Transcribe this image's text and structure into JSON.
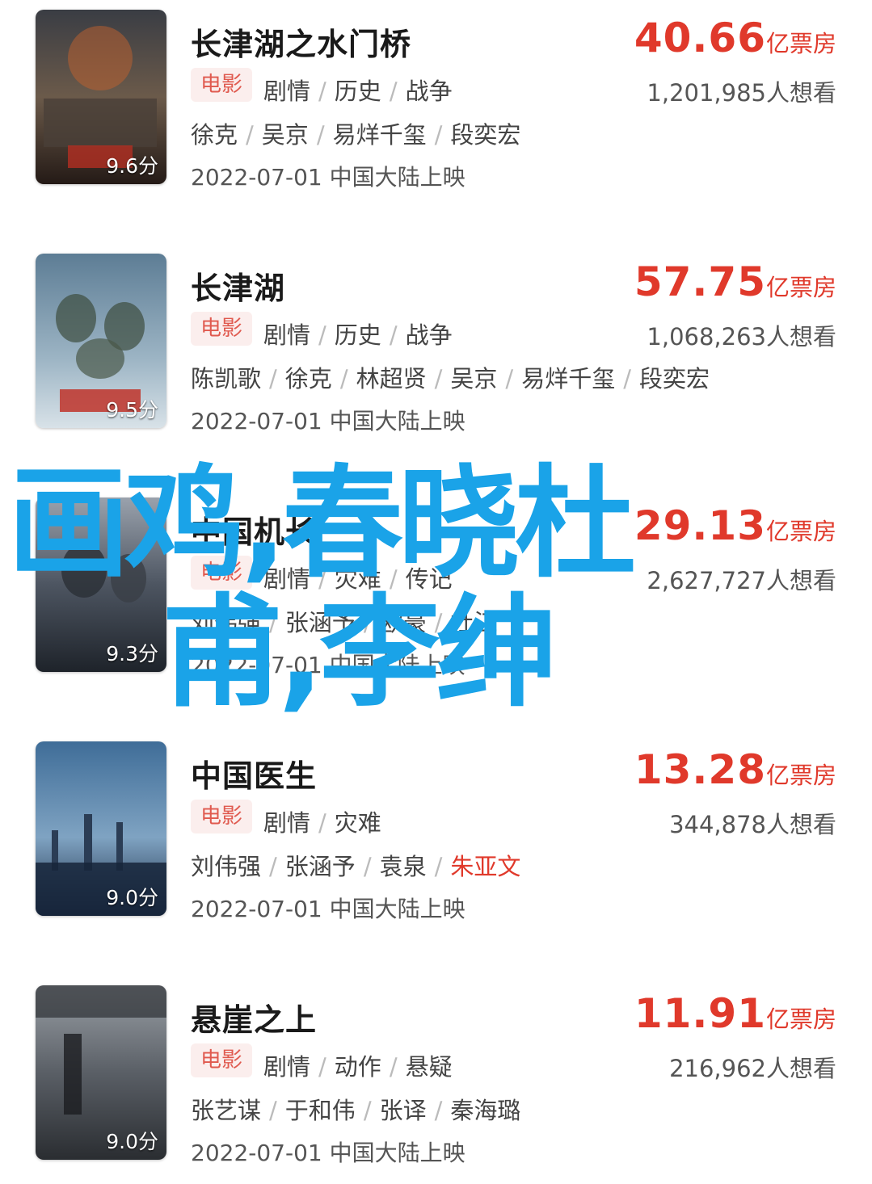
{
  "colors": {
    "accent": "#e0392b",
    "tag_bg": "#fbeeed",
    "overlay": "#1aa3e8"
  },
  "movies": [
    {
      "title": "长津湖之水门桥",
      "tag": "电影",
      "genres": [
        "剧情",
        "历史",
        "战争"
      ],
      "cast": [
        "徐克",
        "吴京",
        "易烊千玺",
        "段奕宏"
      ],
      "release": "2022-07-01 中国大陆上映",
      "box_num": "40.66",
      "box_unit": "亿票房",
      "want": "1,201,985人想看",
      "score": "9.6分"
    },
    {
      "title": "长津湖",
      "tag": "电影",
      "genres": [
        "剧情",
        "历史",
        "战争"
      ],
      "cast": [
        "陈凯歌",
        "徐克",
        "林超贤",
        "吴京",
        "易烊千玺",
        "段奕宏"
      ],
      "release": "2022-07-01 中国大陆上映",
      "box_num": "57.75",
      "box_unit": "亿票房",
      "want": "1,068,263人想看",
      "score": "9.5分"
    },
    {
      "title": "中国机长",
      "tag": "电影",
      "genres": [
        "剧情",
        "灾难",
        "传记"
      ],
      "cast": [
        "刘伟强",
        "张涵予",
        "欧豪",
        "杜江"
      ],
      "release": "2022-07-01 中国大陆上映",
      "box_num": "29.13",
      "box_unit": "亿票房",
      "want": "2,627,727人想看",
      "score": "9.3分"
    },
    {
      "title": "中国医生",
      "tag": "电影",
      "genres": [
        "剧情",
        "灾难"
      ],
      "cast": [
        "刘伟强",
        "张涵予",
        "袁泉",
        "朱亚文"
      ],
      "cast_highlight_index": 3,
      "release": "2022-07-01 中国大陆上映",
      "box_num": "13.28",
      "box_unit": "亿票房",
      "want": "344,878人想看",
      "score": "9.0分"
    },
    {
      "title": "悬崖之上",
      "tag": "电影",
      "genres": [
        "剧情",
        "动作",
        "悬疑"
      ],
      "cast": [
        "张艺谋",
        "于和伟",
        "张译",
        "秦海璐"
      ],
      "release": "2022-07-01 中国大陆上映",
      "box_num": "11.91",
      "box_unit": "亿票房",
      "want": "216,962人想看",
      "score": "9.0分"
    }
  ],
  "overlay_text": {
    "line1": "画鸡,春晓杜",
    "line2": "甫,李绅"
  }
}
